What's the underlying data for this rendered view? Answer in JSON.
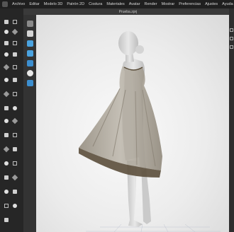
{
  "menu": [
    "Archivo",
    "Editar",
    "Modelo 3D",
    "Patrón 2D",
    "Costura",
    "Materiales",
    "Avatar",
    "Render",
    "Mostrar",
    "Preferencias",
    "Ajustes",
    "Ayuda"
  ],
  "title": "Prueba.zprj",
  "colors": {
    "viewport_bg": "#eeeeee",
    "toolbar_bg": "#262626",
    "menubar_bg": "#1f1f1f",
    "garment": "#a7a092",
    "hem_band": "#5b4e3b",
    "avatar": "#d9d9d9"
  }
}
